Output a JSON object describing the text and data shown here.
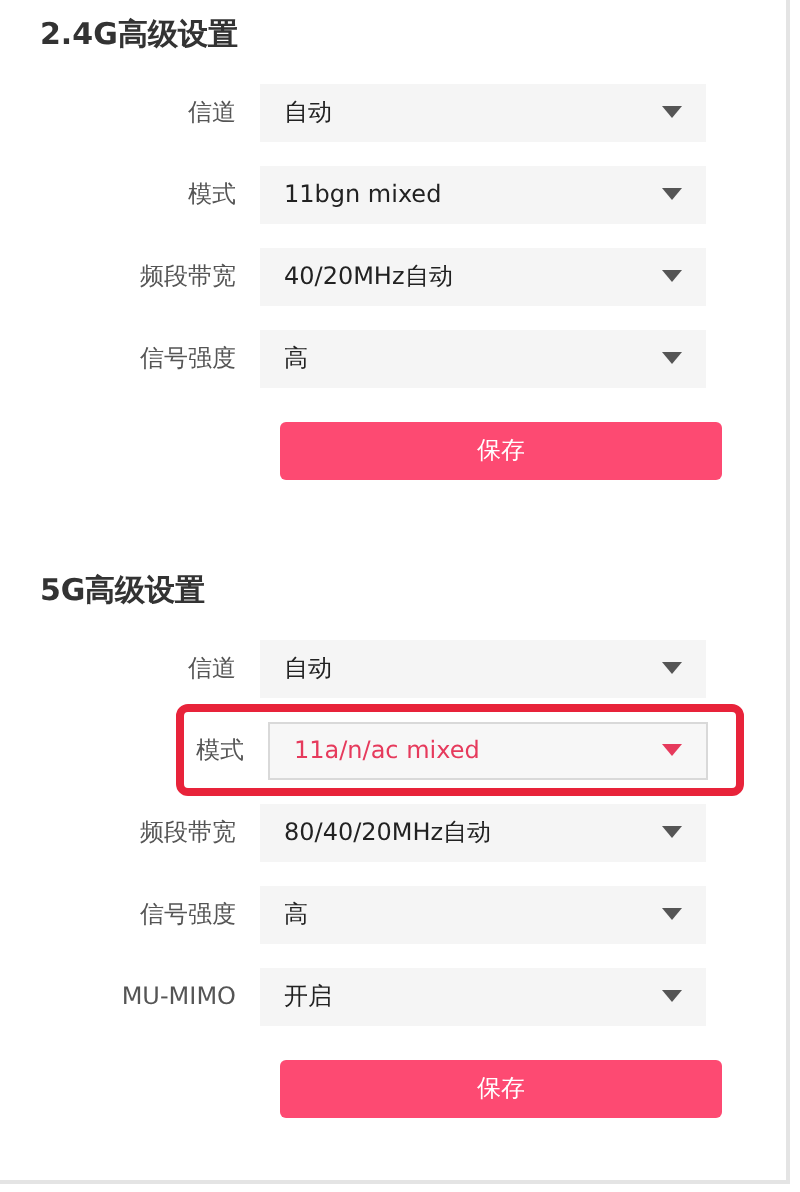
{
  "sections": [
    {
      "title": "2.4G高级设置",
      "rows": [
        {
          "label": "信道",
          "value": "自动",
          "highlighted": false
        },
        {
          "label": "模式",
          "value": "11bgn mixed",
          "highlighted": false
        },
        {
          "label": "频段带宽",
          "value": "40/20MHz自动",
          "highlighted": false
        },
        {
          "label": "信号强度",
          "value": "高",
          "highlighted": false
        }
      ],
      "button": "保存"
    },
    {
      "title": "5G高级设置",
      "rows": [
        {
          "label": "信道",
          "value": "自动",
          "highlighted": false
        },
        {
          "label": "模式",
          "value": "11a/n/ac mixed",
          "highlighted": true
        },
        {
          "label": "频段带宽",
          "value": "80/40/20MHz自动",
          "highlighted": false
        },
        {
          "label": "信号强度",
          "value": "高",
          "highlighted": false
        },
        {
          "label": "MU-MIMO",
          "value": "开启",
          "highlighted": false
        }
      ],
      "button": "保存"
    }
  ]
}
